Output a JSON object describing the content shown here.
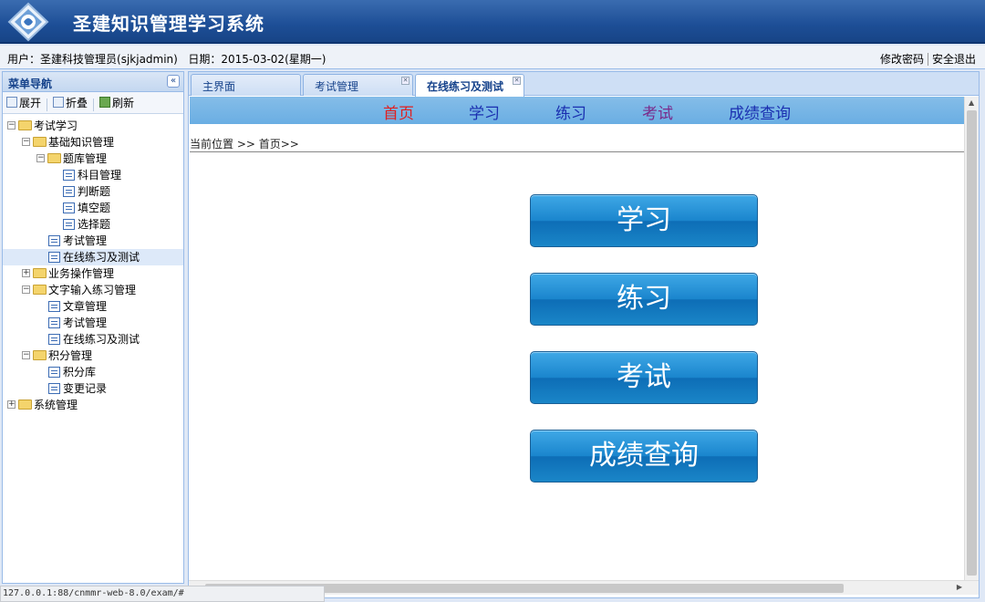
{
  "header": {
    "title": "圣建知识管理学习系统",
    "logo_icon": "logo-icon"
  },
  "userbar": {
    "user_label": "用户：",
    "user_value": "圣建科技管理员(sjkjadmin)",
    "date_label": "日期：",
    "date_value": "2015-03-02(星期一)",
    "change_password": "修改密码",
    "logout": "安全退出"
  },
  "sidebar": {
    "title": "菜单导航",
    "toolbar": {
      "expand": "展开",
      "collapse": "折叠",
      "refresh": "刷新"
    },
    "tree": [
      {
        "label": "考试学习",
        "type": "folder",
        "expanded": true
      },
      {
        "label": "基础知识管理",
        "type": "folder",
        "expanded": true
      },
      {
        "label": "题库管理",
        "type": "folder",
        "expanded": true
      },
      {
        "label": "科目管理",
        "type": "page"
      },
      {
        "label": "判断题",
        "type": "page"
      },
      {
        "label": "填空题",
        "type": "page"
      },
      {
        "label": "选择题",
        "type": "page"
      },
      {
        "label": "考试管理",
        "type": "page"
      },
      {
        "label": "在线练习及测试",
        "type": "page",
        "selected": true
      },
      {
        "label": "业务操作管理",
        "type": "folder",
        "expanded": false
      },
      {
        "label": "文字输入练习管理",
        "type": "folder",
        "expanded": true
      },
      {
        "label": "文章管理",
        "type": "page"
      },
      {
        "label": "考试管理",
        "type": "page"
      },
      {
        "label": "在线练习及测试",
        "type": "page"
      },
      {
        "label": "积分管理",
        "type": "folder",
        "expanded": true
      },
      {
        "label": "积分库",
        "type": "page"
      },
      {
        "label": "变更记录",
        "type": "page"
      },
      {
        "label": "系统管理",
        "type": "folder",
        "expanded": false
      }
    ]
  },
  "tabs": [
    {
      "label": "主界面"
    },
    {
      "label": "考试管理"
    },
    {
      "label": "在线练习及测试",
      "active": true
    }
  ],
  "nav": {
    "home": "首页",
    "study": "学习",
    "practice": "练习",
    "exam": "考试",
    "scores": "成绩查询"
  },
  "breadcrumb": "当前位置 >> 首页>>",
  "buttons": {
    "study": "学习",
    "practice": "练习",
    "exam": "考试",
    "scores": "成绩查询"
  },
  "statusbar": "127.0.0.1:88/cnmmr-web-8.0/exam/#",
  "colors": {
    "header": "#1d4e96",
    "nav_active": "#e02020",
    "button": "#1a85cd"
  }
}
